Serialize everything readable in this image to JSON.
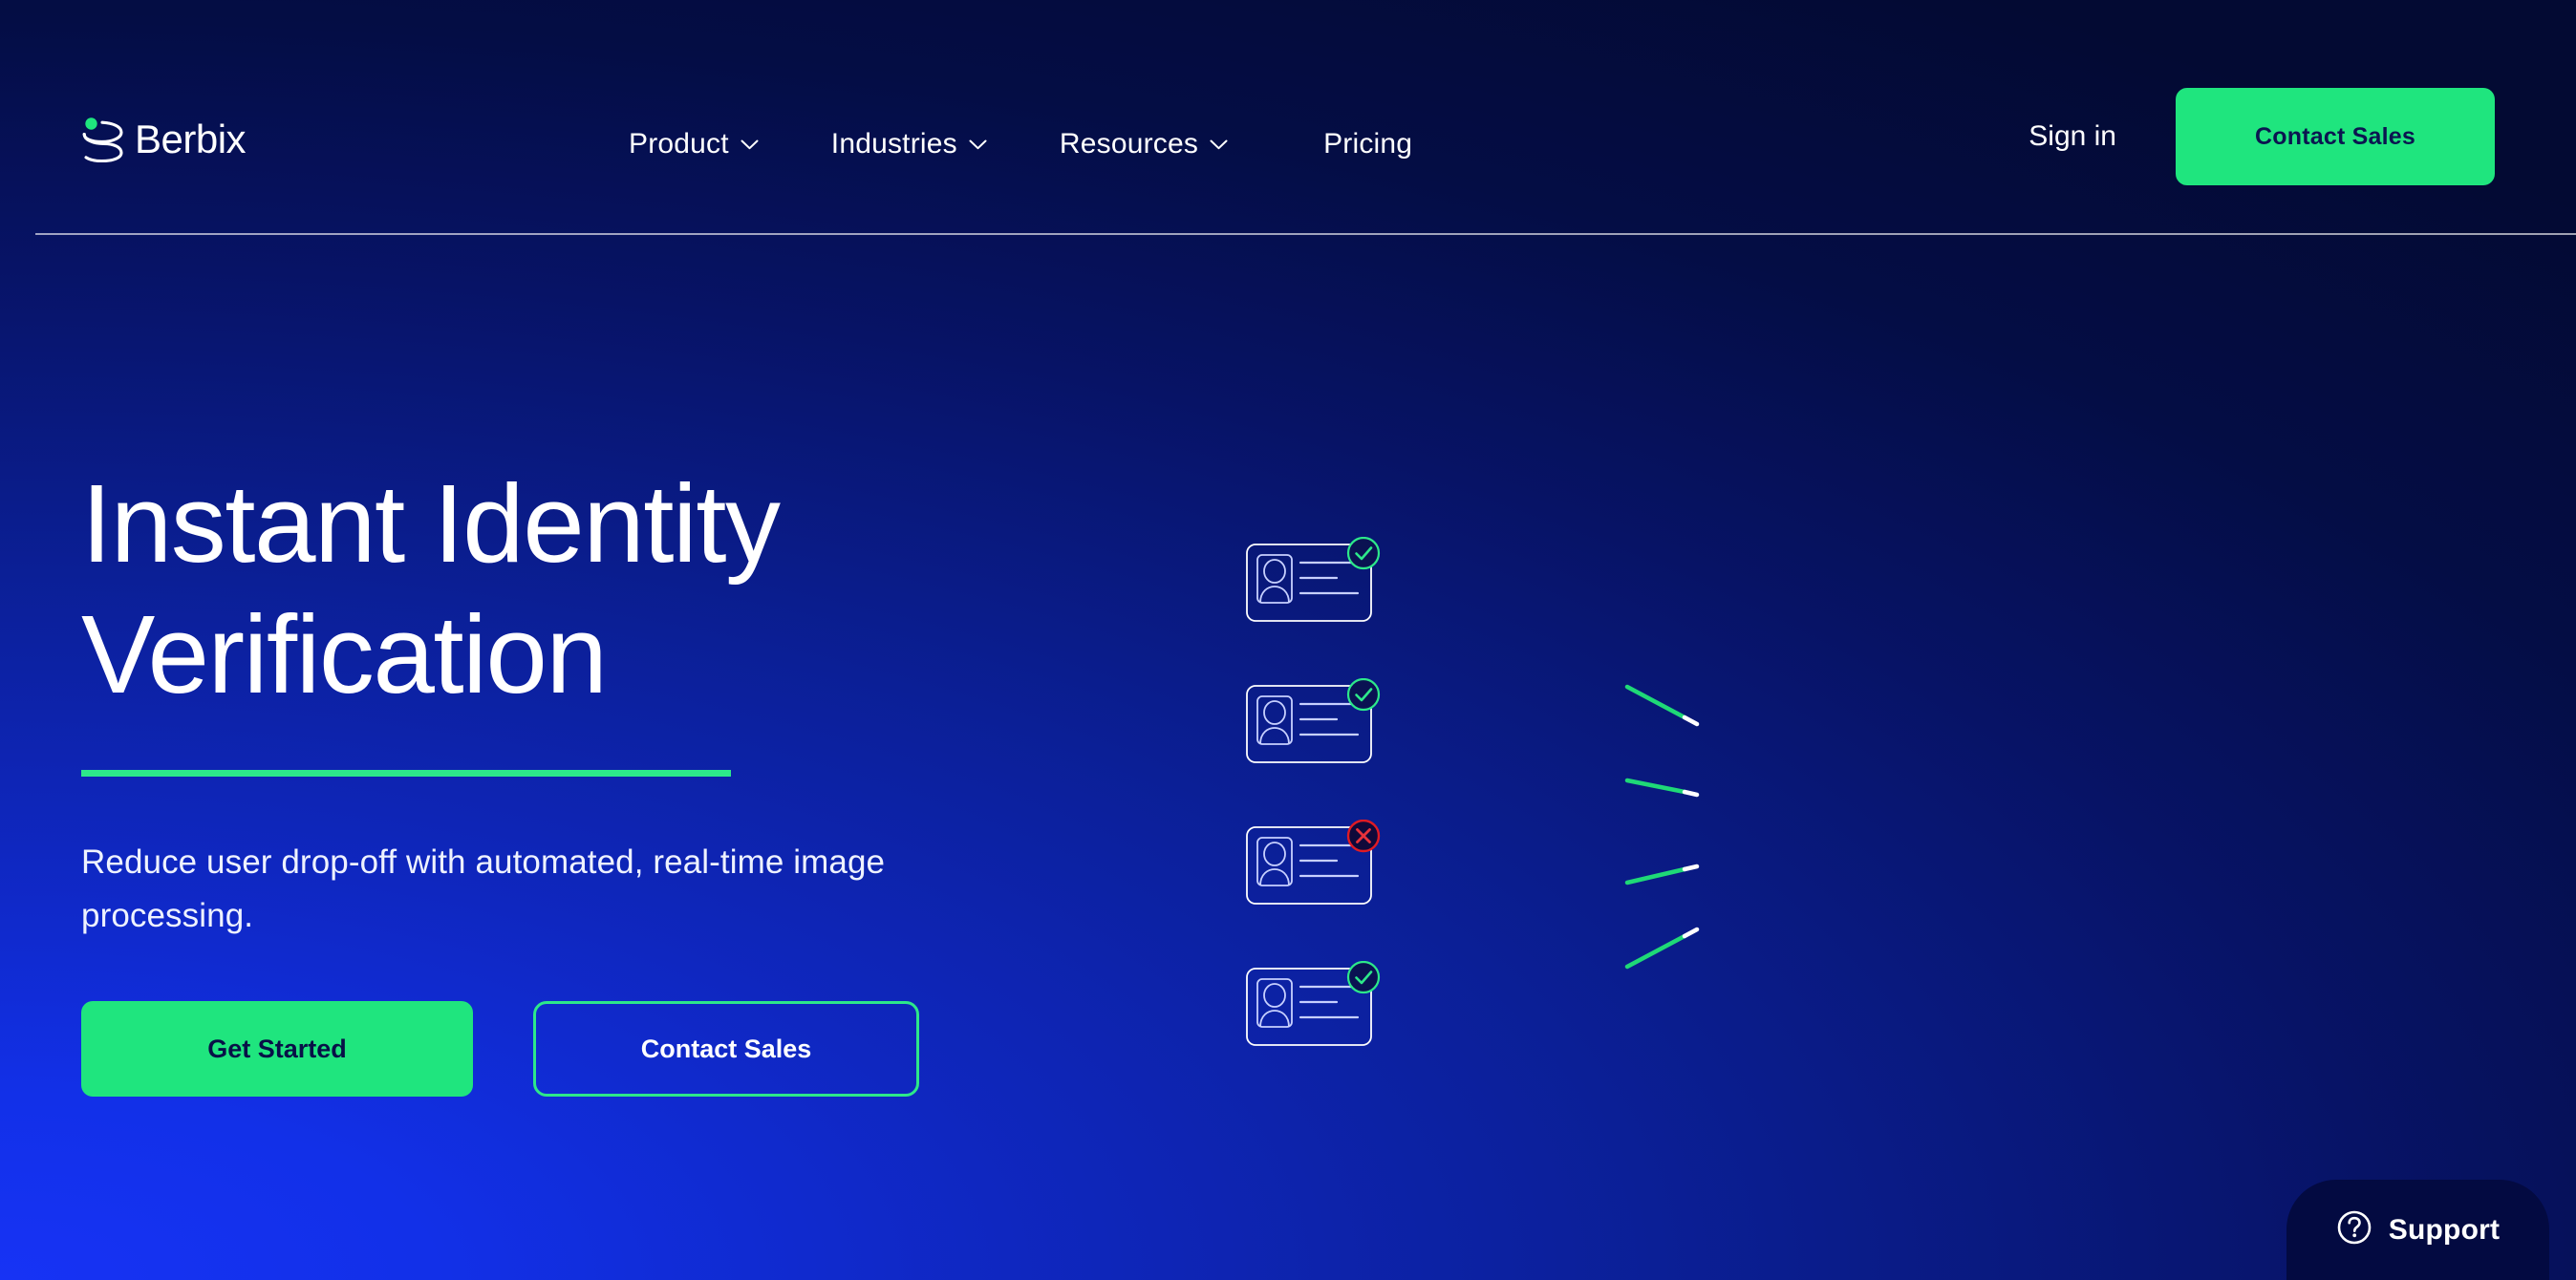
{
  "brand": {
    "name": "Berbix",
    "logo_icon": "berbix-spiral-logo-icon",
    "accent_green": "#1FE57E",
    "accent_line_green": "#2DE88A",
    "deep_navy": "#030a41",
    "bg_gradient_from": "#1733f5",
    "bg_gradient_to": "#030a33"
  },
  "header": {
    "nav_items": [
      {
        "label": "Product",
        "has_dropdown": true
      },
      {
        "label": "Industries",
        "has_dropdown": true
      },
      {
        "label": "Resources",
        "has_dropdown": true
      },
      {
        "label": "Pricing",
        "has_dropdown": false
      }
    ],
    "signin_label": "Sign in",
    "contact_sales_label": "Contact Sales"
  },
  "hero": {
    "title_line1": "Instant Identity",
    "title_line2": "Verification",
    "subtitle": "Reduce user drop-off with automated, real-time image processing.",
    "cta_primary_label": "Get Started",
    "cta_secondary_label": "Contact Sales"
  },
  "illustration": {
    "id_cards": [
      {
        "status": "approved",
        "badge_icon": "check-circle-icon",
        "badge_color": "#2DE88A"
      },
      {
        "status": "approved",
        "badge_icon": "check-circle-icon",
        "badge_color": "#2DE88A"
      },
      {
        "status": "rejected",
        "badge_icon": "x-circle-icon",
        "badge_color": "#E01B24"
      },
      {
        "status": "approved",
        "badge_icon": "check-circle-icon",
        "badge_color": "#2DE88A"
      }
    ],
    "sparks": [
      {
        "direction": "down",
        "color": "#1FD977"
      },
      {
        "direction": "down-slight",
        "color": "#1FD977"
      },
      {
        "direction": "up-slight",
        "color": "#1FD977"
      },
      {
        "direction": "up",
        "color": "#1FD977"
      }
    ]
  },
  "support_widget": {
    "label": "Support",
    "icon": "question-circle-icon"
  }
}
